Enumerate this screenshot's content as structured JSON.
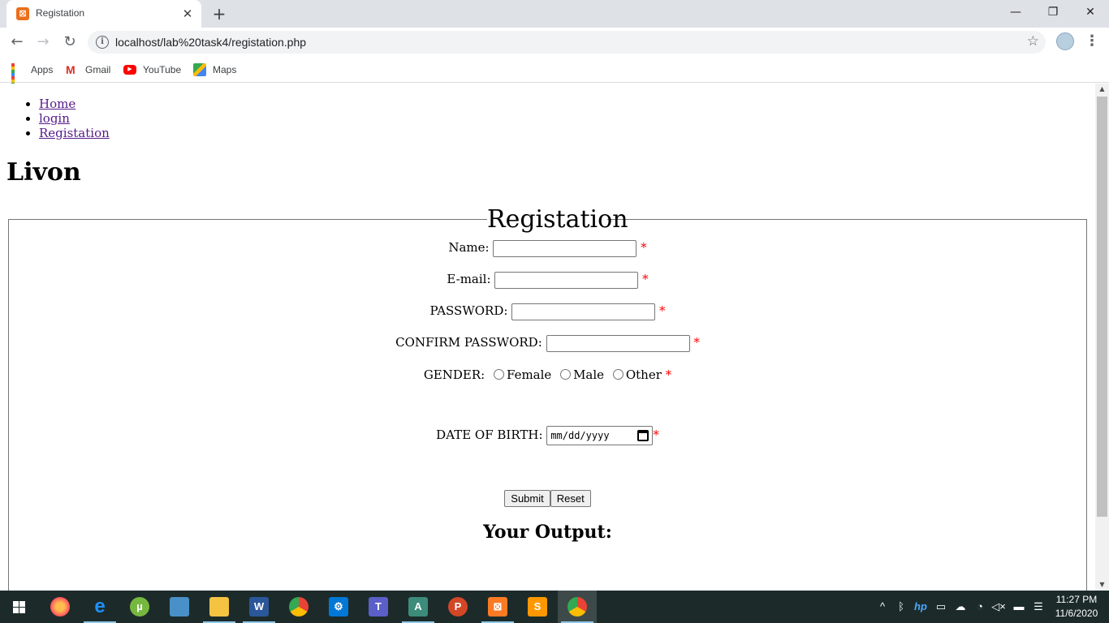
{
  "browser": {
    "tab_title": "Registation",
    "tab_close": "✕",
    "new_tab": "+",
    "url": "localhost/lab%20task4/registation.php",
    "window_controls": {
      "minimize": "—",
      "restore": "❐",
      "close": "✕"
    },
    "bookmarks": [
      {
        "label": "Apps",
        "icon": "apps-grid-icon"
      },
      {
        "label": "Gmail",
        "icon": "gmail-icon"
      },
      {
        "label": "YouTube",
        "icon": "youtube-icon"
      },
      {
        "label": "Maps",
        "icon": "maps-icon"
      }
    ]
  },
  "page": {
    "nav": [
      {
        "label": "Home"
      },
      {
        "label": "login"
      },
      {
        "label": "Registation"
      }
    ],
    "brand": "Livon",
    "form": {
      "legend": "Registation",
      "required_marker": "*",
      "name_label": "Name:",
      "email_label": "E-mail:",
      "password_label": "PASSWORD:",
      "confirm_label": "CONFIRM PASSWORD:",
      "gender_label": "GENDER:",
      "gender_options": [
        "Female",
        "Male",
        "Other"
      ],
      "dob_label": "DATE OF BIRTH:",
      "dob_placeholder": "mm/dd/yyyy",
      "submit_label": "Submit",
      "reset_label": "Reset"
    },
    "output_title": "Your Output:"
  },
  "taskbar": {
    "apps": [
      "Firefox",
      "Edge",
      "uTorrent",
      "Explorer",
      "File Explorer",
      "Word",
      "Chrome",
      "Settings",
      "Teams",
      "Anaconda",
      "PowerPoint",
      "XAMPP",
      "Sublime Text",
      "Chrome"
    ],
    "time": "11:27 PM",
    "date": "11/6/2020"
  },
  "colors": {
    "accent_link": "#551a8b",
    "required": "#ff0000",
    "taskbar_bg": "#1c2b2a"
  }
}
